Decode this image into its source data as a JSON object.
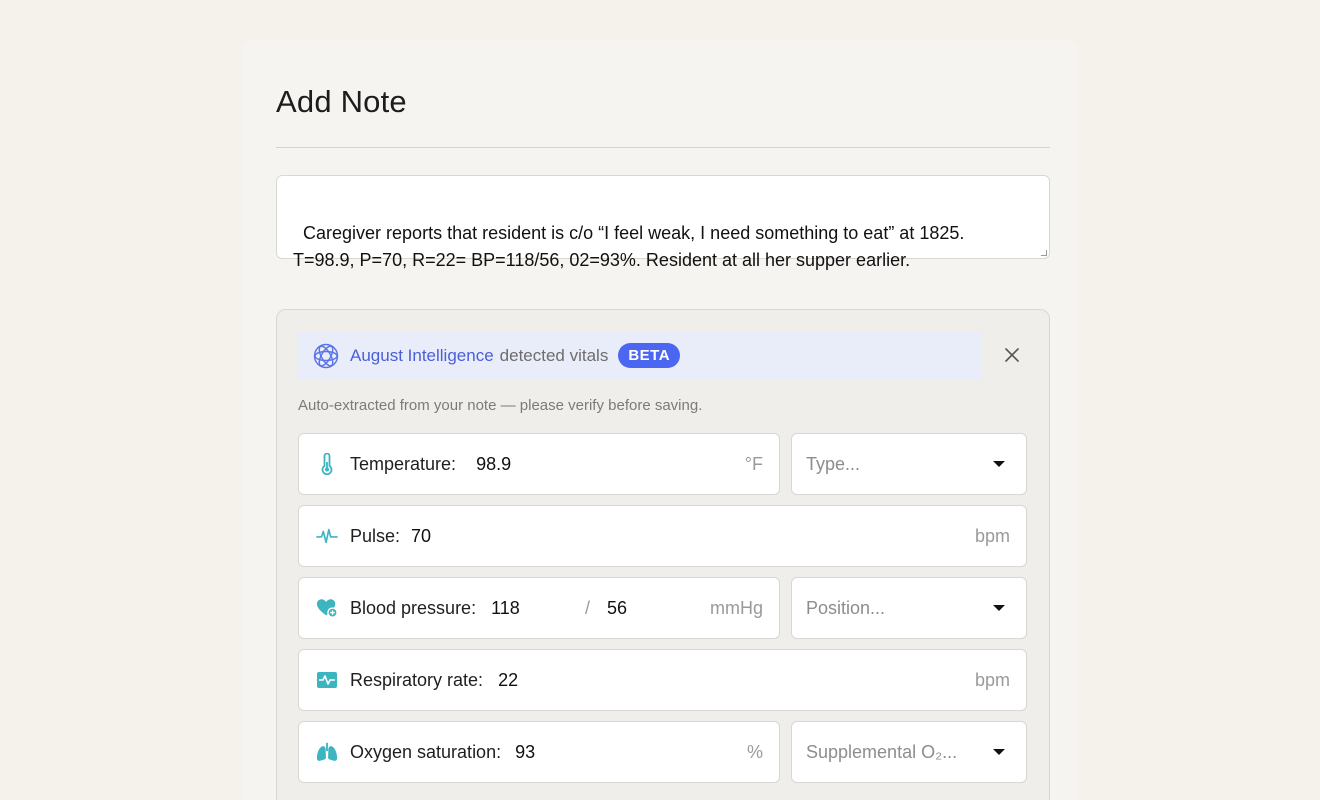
{
  "page": {
    "title": "Add Note"
  },
  "note": {
    "text": "Caregiver reports that resident is c/o “I feel weak, I need something to eat” at 1825.\nT=98.9, P=70, R=22= BP=118/56, 02=93%. Resident at all her supper earlier."
  },
  "ai_banner": {
    "brand": "August Intelligence",
    "text": "detected vitals",
    "badge": "BETA",
    "subtitle": "Auto-extracted from your note — please verify before saving."
  },
  "vitals": {
    "temperature": {
      "label": "Temperature:",
      "value": "98.9",
      "unit": "°F",
      "select_placeholder": "Type..."
    },
    "pulse": {
      "label": "Pulse:",
      "value": "70",
      "unit": "bpm"
    },
    "blood_pressure": {
      "label": "Blood pressure:",
      "systolic": "118",
      "separator": "/",
      "diastolic": "56",
      "unit": "mmHg",
      "select_placeholder": "Position..."
    },
    "respiratory_rate": {
      "label": "Respiratory rate:",
      "value": "22",
      "unit": "bpm"
    },
    "oxygen_saturation": {
      "label": "Oxygen saturation:",
      "value": "93",
      "unit": "%",
      "select_placeholder": "Supplemental O₂..."
    }
  },
  "colors": {
    "accent": "#4b66f0",
    "icon_teal": "#3db5c0",
    "brand_text": "#4a5fd6"
  },
  "icons": [
    "ai-knot-icon",
    "close-icon",
    "thermometer-icon",
    "pulse-icon",
    "heart-plus-icon",
    "monitor-icon",
    "lungs-icon",
    "caret-down-icon"
  ]
}
